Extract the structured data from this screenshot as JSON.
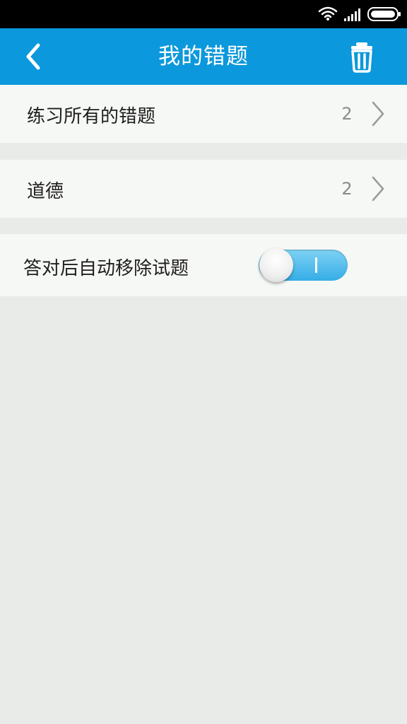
{
  "header": {
    "title": "我的错题",
    "back_icon": "chevron-left-icon",
    "delete_icon": "trash-icon"
  },
  "rows": [
    {
      "label": "练习所有的错题",
      "count": "2",
      "icon": "chevron-right-icon"
    },
    {
      "label": "道德",
      "count": "2",
      "icon": "chevron-right-icon"
    }
  ],
  "settings": {
    "auto_remove_label": "答对后自动移除试题",
    "auto_remove_on": true
  },
  "status_bar": {
    "icons": [
      "wifi-icon",
      "signal-icon",
      "battery-icon"
    ]
  },
  "colors": {
    "accent": "#0c98dc",
    "background": "#e8ebe7",
    "row_background": "#f6f8f5",
    "toggle_on": "#35ade6"
  }
}
